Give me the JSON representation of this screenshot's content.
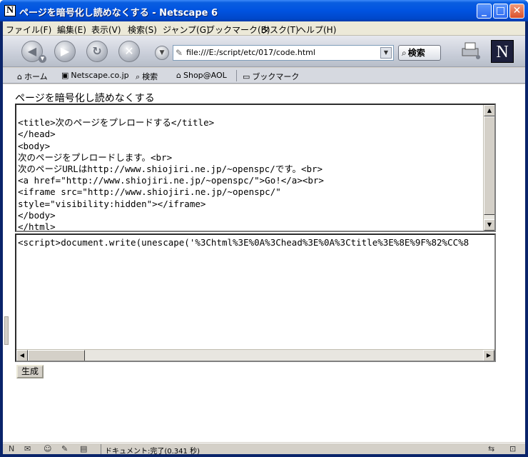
{
  "window": {
    "app_icon_letter": "N",
    "title": "ページを暗号化し読めなくする - Netscape 6"
  },
  "menu": [
    "ファイル(F)",
    "編集(E)",
    "表示(V)",
    "検索(S)",
    "ジャンプ(G)",
    "ブックマーク(B)",
    "タスク(T)",
    "ヘルプ(H)"
  ],
  "toolbar": {
    "url": "file:///E:/script/etc/017/code.html",
    "search_label": "検索",
    "logo_letter": "N"
  },
  "bookmarks": {
    "home": "ホーム",
    "netscape": "Netscape.co.jp",
    "search": "検索",
    "shop": "Shop@AOL",
    "bookmark_folder": "ブックマーク"
  },
  "page": {
    "title": "ページを暗号化し読めなくする",
    "source_lines": [
      "<title>次のページをプレロードする</title>",
      "</head>",
      "<body>",
      "次のページをプレロードします。<br>",
      "次のページURLはhttp://www.shiojiri.ne.jp/~openspc/です。<br>",
      "<a href=\"http://www.shiojiri.ne.jp/~openspc/\">Go!</a><br>",
      "<iframe src=\"http://www.shiojiri.ne.jp/~openspc/\"",
      "style=\"visibility:hidden\"></iframe>",
      "</body>",
      "</html>"
    ],
    "output_text": "<script>document.write(unescape('%3Chtml%3E%0A%3Chead%3E%0A%3Ctitle%3E%8E%9F%82%CC%8",
    "generate_button": "生成"
  },
  "status": {
    "text": "ドキュメント:完了(0.341 秒)"
  },
  "colors": {
    "titlebar": "#0053e0",
    "client_bg": "#d4d0c8"
  }
}
